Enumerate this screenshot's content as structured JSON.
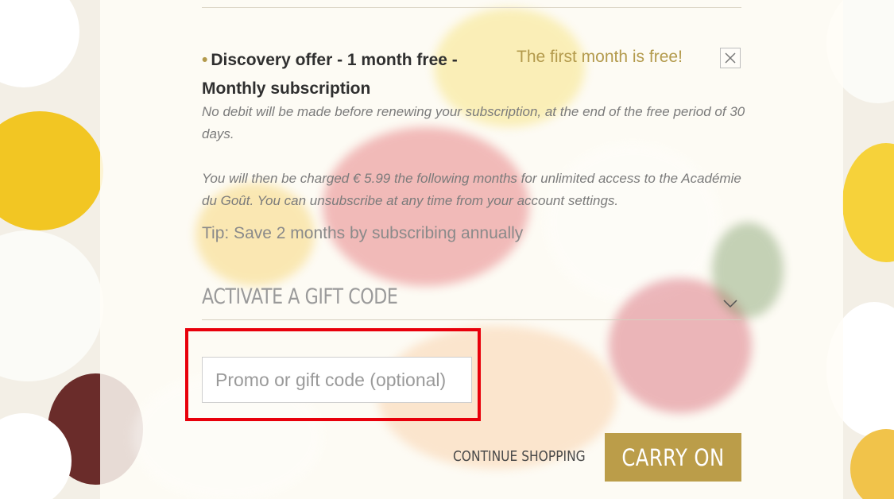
{
  "offer": {
    "bullet": "•",
    "title": "Discovery offer - 1 month free - Monthly subscription",
    "promo_text": "The first month is free!",
    "description_1": "No debit will be made before renewing your subscription, at the end of the free period of 30 days.",
    "description_2": "You will then be charged € 5.99 the following months for unlimited access to the Académie du Goût. You can unsubscribe at any time from your account settings.",
    "tip": "Tip: Save 2 months by subscribing annually"
  },
  "gift_code": {
    "section_title": "ACTIVATE A GIFT CODE",
    "input_value": "",
    "input_placeholder": "Promo or gift code (optional)"
  },
  "actions": {
    "continue_label": "CONTINUE SHOPPING",
    "carry_on_label": "CARRY ON"
  },
  "icons": {
    "close": "close-icon",
    "expand": "chevron-down-icon"
  },
  "colors": {
    "accent_gold": "#bb9d49",
    "highlight_red": "#e8000b"
  }
}
